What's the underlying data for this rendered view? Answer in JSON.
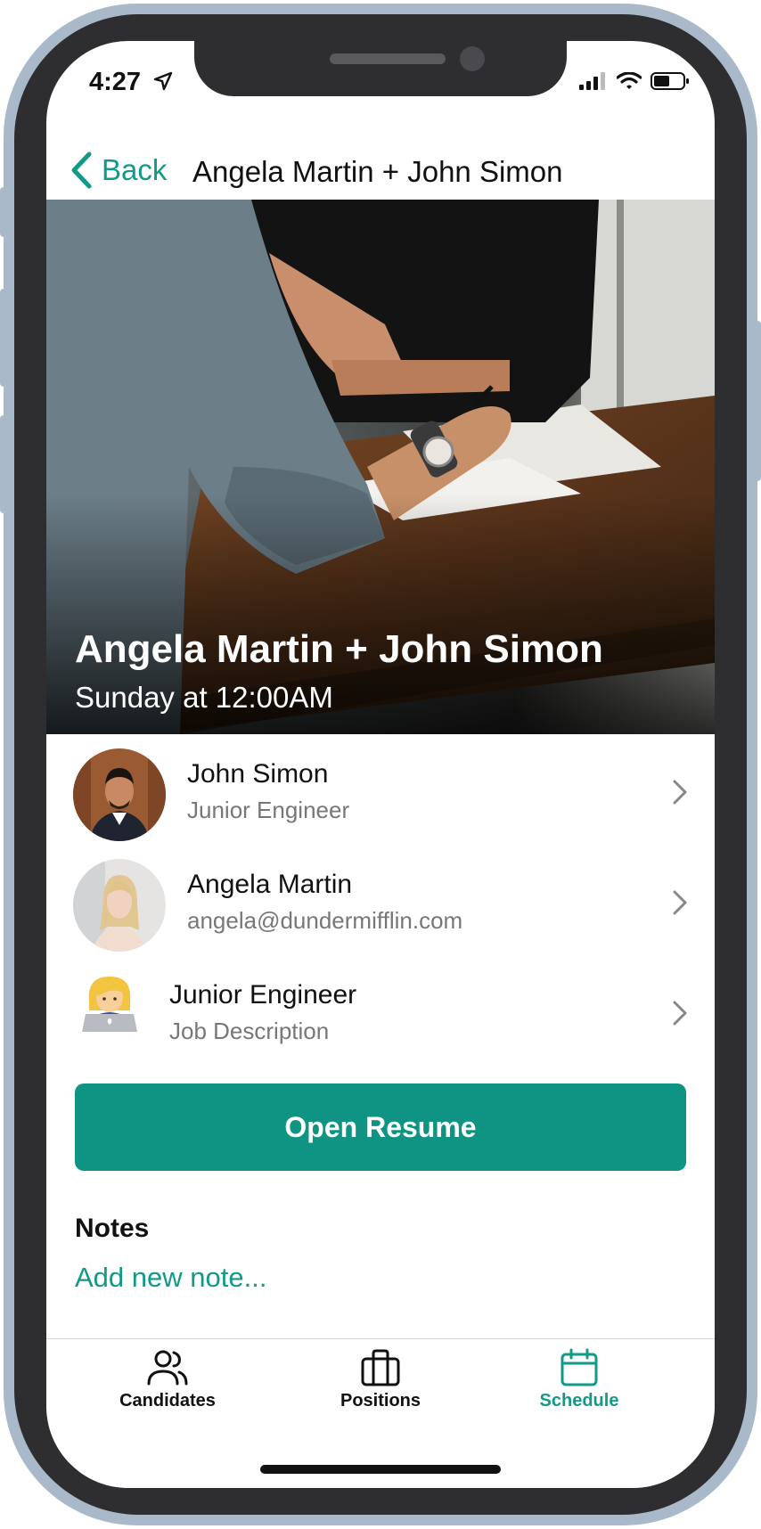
{
  "status_bar": {
    "time": "4:27"
  },
  "navbar": {
    "back_label": "Back",
    "title": "Angela Martin + John Simon"
  },
  "hero": {
    "title": "Angela Martin + John Simon",
    "subtitle": "Sunday at 12:00AM"
  },
  "list": [
    {
      "title": "John Simon",
      "subtitle": "Junior Engineer"
    },
    {
      "title": "Angela Martin",
      "subtitle": "angela@dundermifflin.com"
    },
    {
      "title": "Junior Engineer",
      "subtitle": "Job Description"
    }
  ],
  "open_resume_label": "Open Resume",
  "notes": {
    "heading": "Notes",
    "add_label": "Add new note..."
  },
  "tabs": [
    {
      "label": "Candidates",
      "icon": "users-icon",
      "active": false
    },
    {
      "label": "Positions",
      "icon": "briefcase-icon",
      "active": false
    },
    {
      "label": "Schedule",
      "icon": "calendar-icon",
      "active": true
    }
  ],
  "colors": {
    "accent": "#0f9484",
    "frame": "#a9b9c9",
    "bezel": "#2e2e30"
  }
}
